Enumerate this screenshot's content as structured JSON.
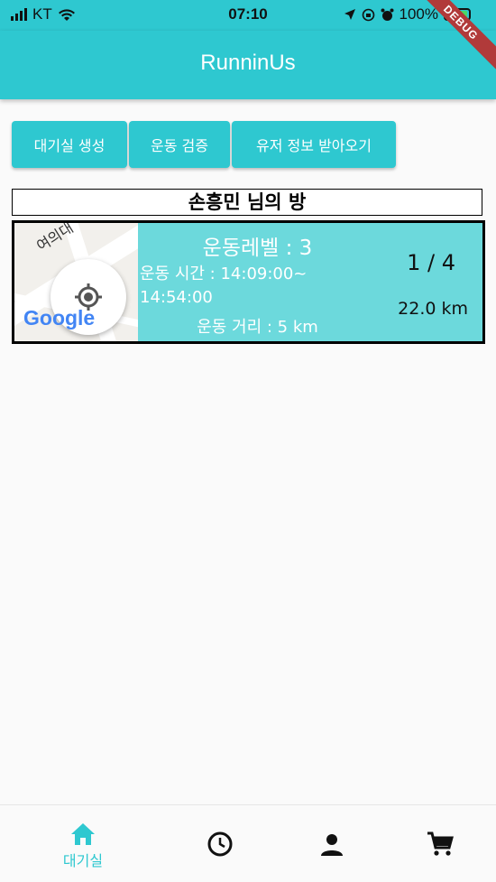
{
  "status_bar": {
    "carrier": "KT",
    "time": "07:10",
    "battery": "100%"
  },
  "app": {
    "title": "RunninUs",
    "debug_banner": "DEBUG"
  },
  "actions": {
    "create_room": "대기실 생성",
    "verify_exercise": "운동 검증",
    "fetch_user_info": "유저 정보 받아오기"
  },
  "room": {
    "title": "손흥민 님의 방",
    "map_road_label": "여의대",
    "map_logo": "Google",
    "level": "운동레벨 : 3",
    "time_line1": "운동 시간 : 14:09:00~",
    "time_line2": "14:54:00",
    "distance": "운동 거리 : 5 km",
    "participants": "1 / 4",
    "total_distance": "22.0 km"
  },
  "nav": {
    "items": [
      {
        "label": "대기실",
        "icon": "home-icon",
        "active": true
      },
      {
        "label": "",
        "icon": "clock-icon",
        "active": false
      },
      {
        "label": "",
        "icon": "person-icon",
        "active": false
      },
      {
        "label": "",
        "icon": "cart-icon",
        "active": false
      }
    ]
  },
  "colors": {
    "primary": "#2ec8d0",
    "card": "#6cd9dc",
    "background": "#fafafa"
  }
}
